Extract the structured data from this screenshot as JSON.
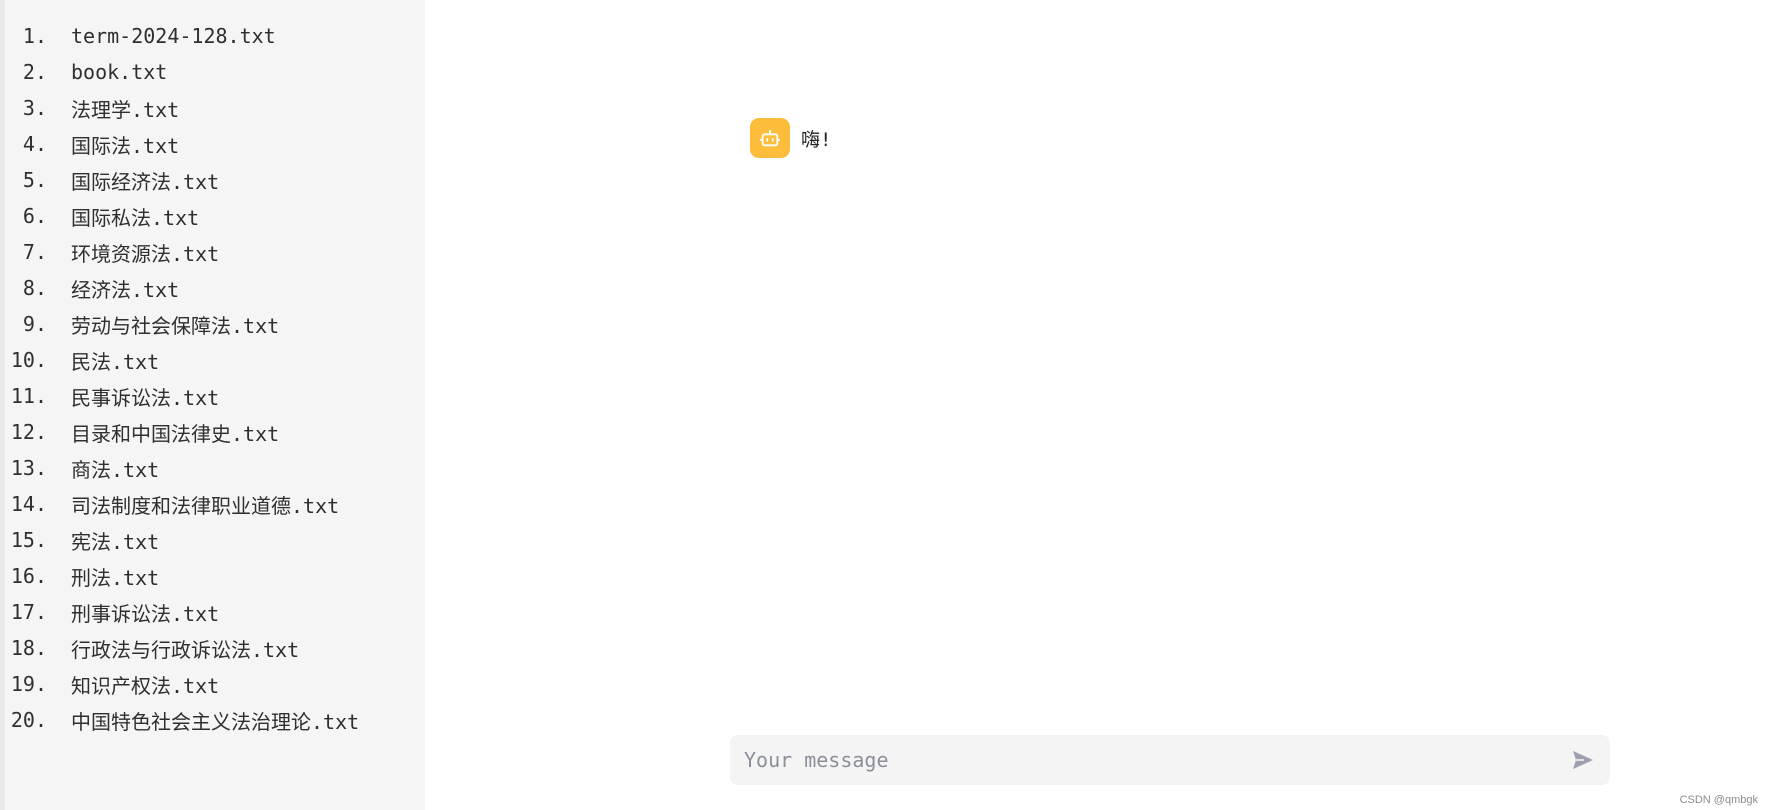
{
  "sidebar": {
    "files": [
      {
        "num": "1.",
        "name": "term-2024-128.txt"
      },
      {
        "num": "2.",
        "name": "book.txt"
      },
      {
        "num": "3.",
        "name": "法理学.txt"
      },
      {
        "num": "4.",
        "name": "国际法.txt"
      },
      {
        "num": "5.",
        "name": "国际经济法.txt"
      },
      {
        "num": "6.",
        "name": "国际私法.txt"
      },
      {
        "num": "7.",
        "name": "环境资源法.txt"
      },
      {
        "num": "8.",
        "name": "经济法.txt"
      },
      {
        "num": "9.",
        "name": "劳动与社会保障法.txt"
      },
      {
        "num": "10.",
        "name": "民法.txt"
      },
      {
        "num": "11.",
        "name": "民事诉讼法.txt"
      },
      {
        "num": "12.",
        "name": "目录和中国法律史.txt"
      },
      {
        "num": "13.",
        "name": "商法.txt"
      },
      {
        "num": "14.",
        "name": "司法制度和法律职业道德.txt"
      },
      {
        "num": "15.",
        "name": "宪法.txt"
      },
      {
        "num": "16.",
        "name": "刑法.txt"
      },
      {
        "num": "17.",
        "name": "刑事诉讼法.txt"
      },
      {
        "num": "18.",
        "name": "行政法与行政诉讼法.txt"
      },
      {
        "num": "19.",
        "name": "知识产权法.txt"
      },
      {
        "num": "20.",
        "name": "中国特色社会主义法治理论.txt"
      }
    ]
  },
  "chat": {
    "messages": [
      {
        "avatar_icon": "robot-icon",
        "avatar_color": "#fbbd3a",
        "text": "嗨!"
      }
    ]
  },
  "composer": {
    "placeholder": "Your message",
    "send_icon": "send-icon"
  },
  "watermark": "CSDN @qmbgk"
}
